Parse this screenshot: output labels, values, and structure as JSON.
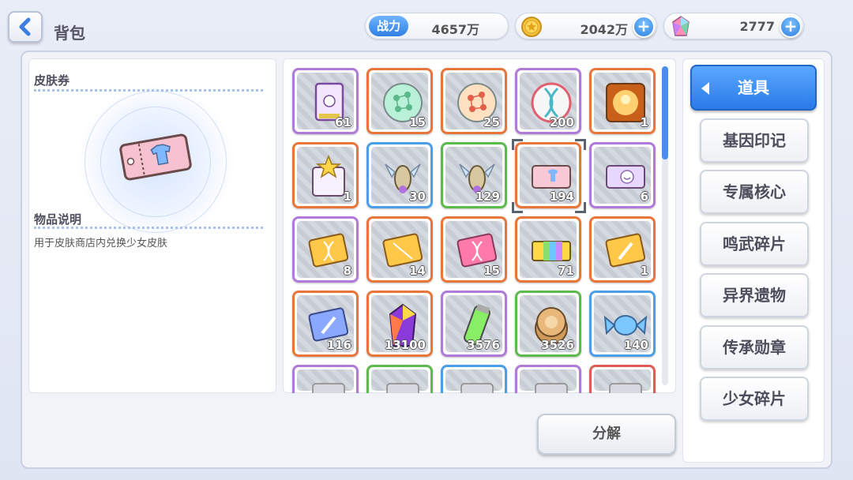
{
  "header": {
    "title": "背包",
    "power_label": "战力",
    "power_value": "4657万",
    "coins_value": "2042万",
    "gems_value": "2777"
  },
  "detail": {
    "item_name": "皮肤券",
    "desc_heading": "物品说明",
    "desc_text": "用于皮肤商店内兑换少女皮肤"
  },
  "grid": {
    "rows": [
      [
        {
          "icon": "scroll-icon",
          "frame": "#b07ad8",
          "count": "61"
        },
        {
          "icon": "green-molecule-orb-icon",
          "frame": "#e8763a",
          "count": "15"
        },
        {
          "icon": "orange-molecule-orb-icon",
          "frame": "#e8763a",
          "count": "25"
        },
        {
          "icon": "dna-orb-icon",
          "frame": "#b07ad8",
          "count": "200"
        },
        {
          "icon": "golden-glow-box-icon",
          "frame": "#e8763a",
          "count": "1"
        }
      ],
      [
        {
          "icon": "star-box-icon",
          "frame": "#e8763a",
          "count": "1"
        },
        {
          "icon": "crystal-beetle-icon",
          "frame": "#4c9ee6",
          "count": "30"
        },
        {
          "icon": "crystal-beetle-icon",
          "frame": "#5dba4e",
          "count": "129"
        },
        {
          "icon": "skin-ticket-icon",
          "frame": "#e8763a",
          "count": "194"
        },
        {
          "icon": "smile-ticket-icon",
          "frame": "#b07ad8",
          "count": "6"
        }
      ],
      [
        {
          "icon": "gold-dna-card-icon",
          "frame": "#b07ad8",
          "count": "8"
        },
        {
          "icon": "gold-card-icon",
          "frame": "#e8763a",
          "count": "14"
        },
        {
          "icon": "pink-dna-card-icon",
          "frame": "#e8763a",
          "count": "15"
        },
        {
          "icon": "rainbow-ticket-icon",
          "frame": "#e8763a",
          "count": "71"
        },
        {
          "icon": "gold-sword-card-icon",
          "frame": "#e8763a",
          "count": "1"
        }
      ],
      [
        {
          "icon": "blue-sword-card-icon",
          "frame": "#e8763a",
          "count": "116"
        },
        {
          "icon": "rainbow-crystal-icon",
          "frame": "#e8763a",
          "count": "13100"
        },
        {
          "icon": "green-battery-icon",
          "frame": "#b07ad8",
          "count": "3576"
        },
        {
          "icon": "cookie-icon",
          "frame": "#5dba4e",
          "count": "3526"
        },
        {
          "icon": "candy-icon",
          "frame": "#4c9ee6",
          "count": "140"
        }
      ],
      [
        {
          "icon": "partial-item-icon",
          "frame": "#b07ad8",
          "count": ""
        },
        {
          "icon": "partial-item-icon",
          "frame": "#5dba4e",
          "count": ""
        },
        {
          "icon": "partial-item-icon",
          "frame": "#4c9ee6",
          "count": ""
        },
        {
          "icon": "partial-item-icon",
          "frame": "#b07ad8",
          "count": ""
        },
        {
          "icon": "partial-item-icon",
          "frame": "#e05a5a",
          "count": ""
        }
      ]
    ]
  },
  "actions": {
    "decompose_label": "分解"
  },
  "categories": [
    {
      "label": "道具",
      "active": true
    },
    {
      "label": "基因印记"
    },
    {
      "label": "专属核心"
    },
    {
      "label": "鸣武碎片"
    },
    {
      "label": "异界遗物"
    },
    {
      "label": "传承勋章"
    },
    {
      "label": "少女碎片"
    }
  ]
}
